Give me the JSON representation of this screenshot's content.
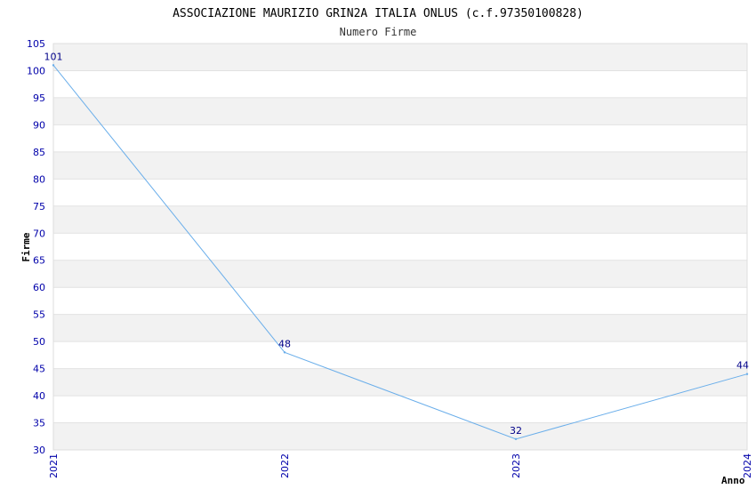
{
  "chart_data": {
    "type": "line",
    "title": "ASSOCIAZIONE MAURIZIO GRIN2A ITALIA ONLUS (c.f.97350100828)",
    "subtitle": "Numero Firme",
    "xlabel": "Anno",
    "ylabel": "Firme",
    "x": [
      "2021",
      "2022",
      "2023",
      "2024"
    ],
    "series": [
      {
        "values": [
          101,
          48,
          32,
          44
        ]
      }
    ],
    "ylim": [
      30,
      105
    ],
    "yticks": [
      30,
      35,
      40,
      45,
      50,
      55,
      60,
      65,
      70,
      75,
      80,
      85,
      90,
      95,
      100,
      105
    ],
    "grid": true,
    "colors": {
      "line": "#6aaeea",
      "band": "#f2f2f2",
      "tick": "#0000aa",
      "data_label": "#000088"
    }
  }
}
